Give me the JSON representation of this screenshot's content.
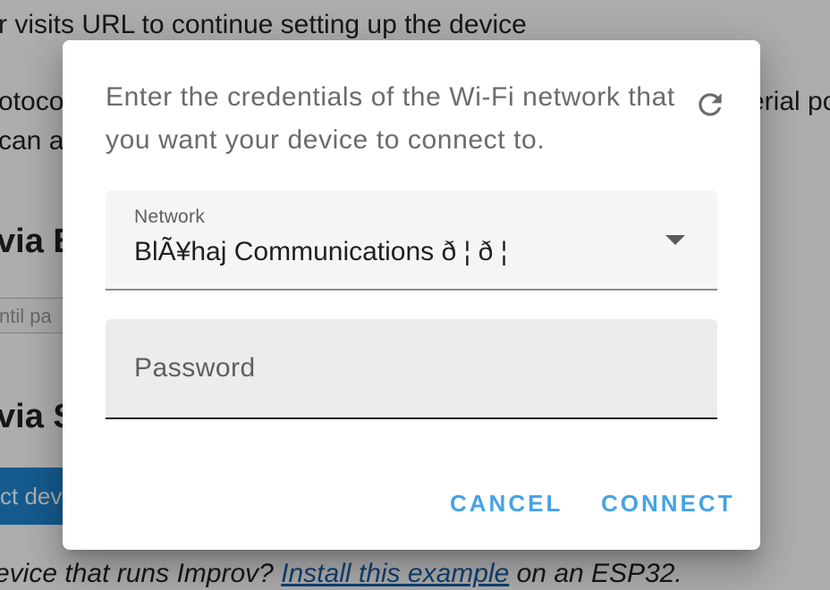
{
  "background": {
    "line1": "r visits URL to continue setting up the device",
    "line2_left": "otoco",
    "line2_right": "erial po",
    "line3": " can a",
    "heading1": "via B",
    "input_placeholder": "ntil pa",
    "heading2": "via S",
    "button_label": "ct dev",
    "footer_prefix": "evice that runs Improv? ",
    "footer_link": "Install this example",
    "footer_suffix": " on an ESP32."
  },
  "dialog": {
    "message": "Enter the credentials of the Wi-Fi network that you want your device to connect to.",
    "refresh_icon": "refresh-icon",
    "network": {
      "label": "Network",
      "value": "BlÃ¥haj Communications ð   ¦   ð   ¦"
    },
    "password": {
      "placeholder": "Password"
    },
    "actions": {
      "cancel_label": "CANCEL",
      "connect_label": "CONNECT"
    }
  },
  "colors": {
    "accent": "#45a3e6",
    "link": "#1a5fa8",
    "background_button": "#1f86d3"
  }
}
